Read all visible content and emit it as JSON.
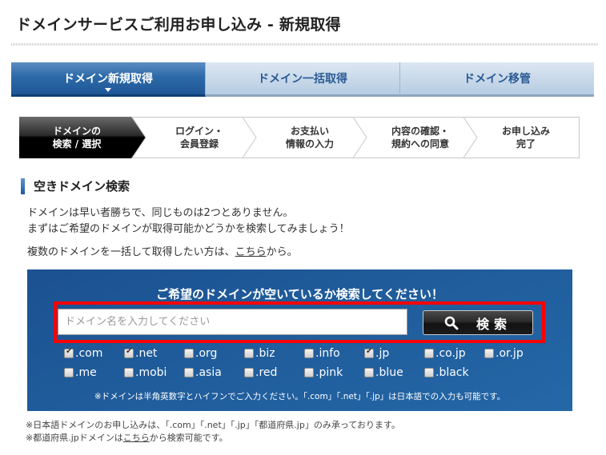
{
  "header": {
    "title": "ドメインサービスご利用お申し込み - 新規取得"
  },
  "tabs": [
    {
      "label": "ドメイン新規取得",
      "active": true
    },
    {
      "label": "ドメイン一括取得",
      "active": false
    },
    {
      "label": "ドメイン移管",
      "active": false
    }
  ],
  "steps": [
    {
      "line1": "ドメインの",
      "line2": "検索 / 選択",
      "current": true
    },
    {
      "line1": "ログイン・",
      "line2": "会員登録",
      "current": false
    },
    {
      "line1": "お支払い",
      "line2": "情報の入力",
      "current": false
    },
    {
      "line1": "内容の確認・",
      "line2": "規約への同意",
      "current": false
    },
    {
      "line1": "お申し込み",
      "line2": "完了",
      "current": false
    }
  ],
  "section": {
    "title": "空きドメイン検索",
    "desc_line1": "ドメインは早い者勝ちで、同じものは2つとありません。",
    "desc_line2": "まずはご希望のドメインが取得可能かどうかを検索してみましょう！",
    "bulk_prefix": "複数のドメインを一括して取得したい方は、",
    "bulk_link": "こちら",
    "bulk_suffix": "から。"
  },
  "search": {
    "heading": "ご希望のドメインが空いているか検索してください！",
    "input_value": "",
    "placeholder": "ドメイン名を入力してください",
    "button_label": "検索",
    "button_icon": "search-icon",
    "tlds": [
      {
        "label": ".com",
        "checked": true
      },
      {
        "label": ".net",
        "checked": true
      },
      {
        "label": ".org",
        "checked": false
      },
      {
        "label": ".biz",
        "checked": false
      },
      {
        "label": ".info",
        "checked": false
      },
      {
        "label": ".jp",
        "checked": true
      },
      {
        "label": ".co.jp",
        "checked": false
      },
      {
        "label": ".or.jp",
        "checked": false
      },
      {
        "label": ".me",
        "checked": false
      },
      {
        "label": ".mobi",
        "checked": false
      },
      {
        "label": ".asia",
        "checked": false
      },
      {
        "label": ".red",
        "checked": false
      },
      {
        "label": ".pink",
        "checked": false
      },
      {
        "label": ".blue",
        "checked": false
      },
      {
        "label": ".black",
        "checked": false
      }
    ],
    "note": "※ドメインは半角英数字とハイフンでご入力ください。「.com」「.net」「.jp」は日本語での入力も可能です。"
  },
  "footnotes": {
    "line1": "※日本語ドメインのお申し込みは、「.com」「.net」「.jp」「都道府県.jp」のみ承っております。",
    "line2_prefix": "※都道府県.jpドメインは",
    "line2_link": "こちら",
    "line2_suffix": "から検索可能です。"
  },
  "colors": {
    "tab_active": "#1e5696",
    "panel_blue": "#205d9c",
    "highlight_red": "#ff0000",
    "step_current": "#000000"
  }
}
